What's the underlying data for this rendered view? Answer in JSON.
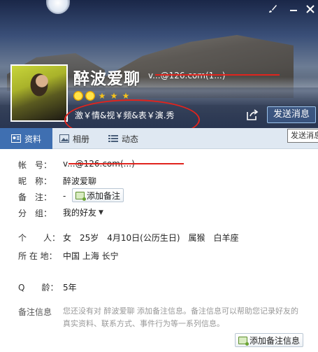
{
  "header": {
    "nickname": "醉波爱聊",
    "account": "v...@126.com(1...)",
    "signature": "激￥情&视￥频&表￥演.秀",
    "send_button": "发送消息",
    "send_tooltip": "发送消息"
  },
  "badges": [
    "smiley-face",
    "smiley-face",
    "star",
    "star",
    "star"
  ],
  "tabs": [
    {
      "label": "资料",
      "icon": "profile-icon",
      "active": true
    },
    {
      "label": "相册",
      "icon": "photo-icon",
      "active": false
    },
    {
      "label": "动态",
      "icon": "feed-icon",
      "active": false
    }
  ],
  "profile": {
    "account_label": "帐　号：",
    "account_value": "v...@126.com(...)",
    "nick_label": "昵　称：",
    "nick_value": "醉波爱聊",
    "remark_label": "备　注：",
    "remark_value": "-",
    "add_remark_button": "添加备注",
    "group_label": "分　组：",
    "group_value": "我的好友",
    "personal_label": "个　　人：",
    "personal_value": "女　25岁　4月10日(公历生日)　属猴　白羊座",
    "location_label": "所 在 地：",
    "location_value": "中国 上海 长宁",
    "qage_label": "Q　　龄：",
    "qage_value": "5年",
    "remark_info_label": "备注信息",
    "remark_info_text": "您还没有对 醉波爱聊 添加备注信息。备注信息可以帮助您记录好友的真实资料、联系方式、事件行为等一系列信息。",
    "add_remark_info_button": "添加备注信息"
  },
  "colors": {
    "accent": "#3f6fb1",
    "annotation_red": "#e3231c"
  }
}
